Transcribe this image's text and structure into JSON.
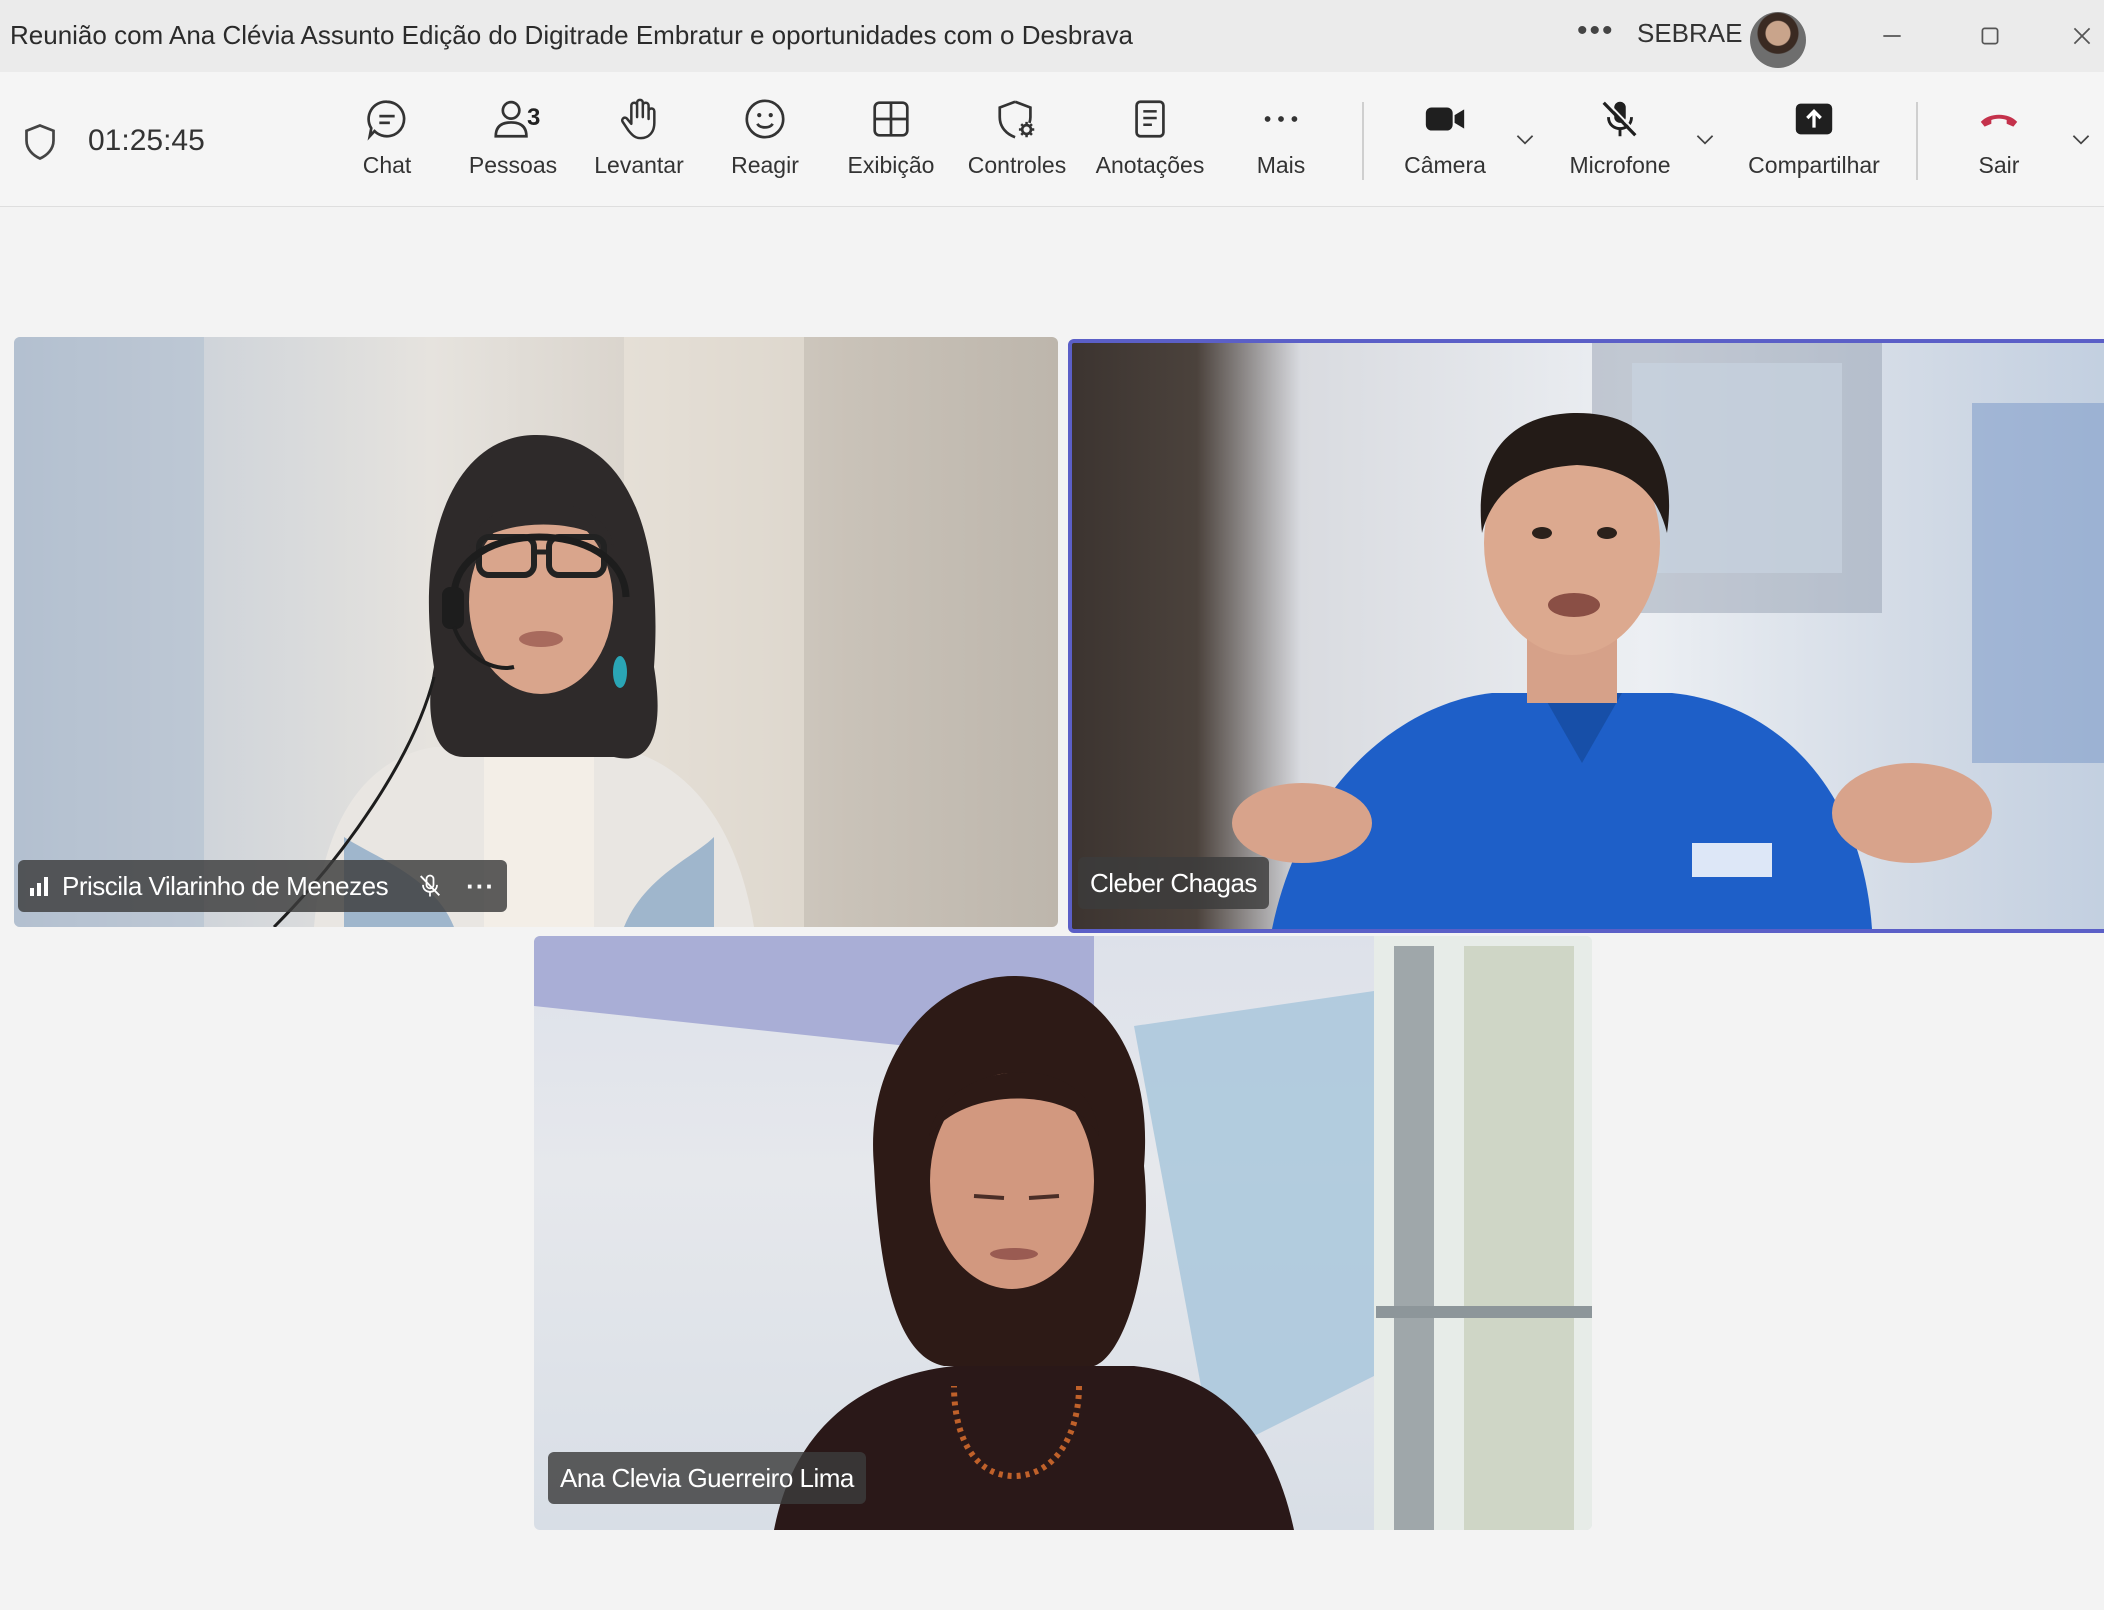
{
  "window": {
    "title": "Reunião com Ana Clévia Assunto Edição do Digitrade Embratur e oportunidades com o Desbrava",
    "more_label": "•••",
    "org_name": "SEBRAE"
  },
  "toolbar": {
    "timer": "01:25:45",
    "people_count": "3",
    "items": [
      {
        "label": "Chat"
      },
      {
        "label": "Pessoas"
      },
      {
        "label": "Levantar"
      },
      {
        "label": "Reagir"
      },
      {
        "label": "Exibição"
      },
      {
        "label": "Controles"
      },
      {
        "label": "Anotações"
      },
      {
        "label": "Mais"
      },
      {
        "label": "Câmera"
      },
      {
        "label": "Microfone"
      },
      {
        "label": "Compartilhar"
      },
      {
        "label": "Sair"
      }
    ],
    "leave_color": "#c4314b"
  },
  "participants": [
    {
      "name": "Priscila Vilarinho de Menezes",
      "muted": true
    },
    {
      "name": "Cleber Chagas",
      "speaking": true
    },
    {
      "name": "Ana Clevia Guerreiro Lima"
    }
  ],
  "colors": {
    "active_speaker_border": "#5b5fc7"
  }
}
